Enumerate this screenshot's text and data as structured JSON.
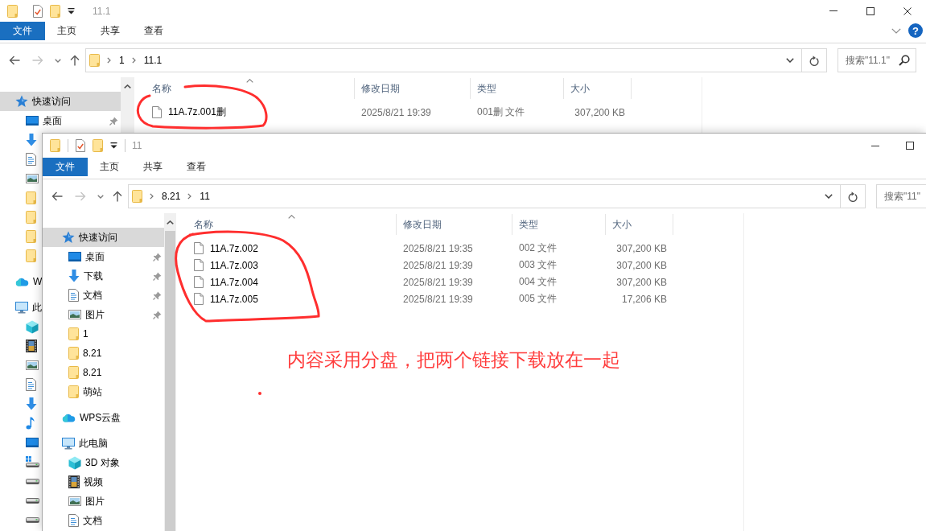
{
  "back_window": {
    "quick_access_toolbar": [
      {
        "kind": "folder"
      },
      {
        "kind": "properties"
      },
      {
        "kind": "folder"
      },
      {
        "kind": "customize"
      }
    ],
    "title": "11.1",
    "controls": [
      {
        "kind": "minimize"
      },
      {
        "kind": "maximize"
      },
      {
        "kind": "close"
      }
    ],
    "ribbon": {
      "tabs": [
        {
          "kind": "file",
          "label": "文件"
        },
        {
          "kind": "tab",
          "label": "主页"
        },
        {
          "kind": "tab",
          "label": "共享"
        },
        {
          "kind": "tab",
          "label": "查看"
        }
      ],
      "expand_toggle": true,
      "help_button": "?"
    },
    "nav_buttons": [
      {
        "kind": "back",
        "disabled": false
      },
      {
        "kind": "forward",
        "disabled": true
      },
      {
        "kind": "recent",
        "disabled": false
      },
      {
        "kind": "up",
        "disabled": false
      }
    ],
    "address": {
      "path": [
        "1",
        "11.1"
      ]
    },
    "search": {
      "placeholder": "搜索\"11.1\""
    },
    "nav_pane": [
      {
        "kind": "quick-access",
        "label": "快速访问",
        "selected": true,
        "pinned": false,
        "children": [
          {
            "kind": "desktop",
            "label": "桌面",
            "selected": false,
            "pinned": true
          },
          {
            "kind": "downloads",
            "selected": false,
            "pinned": false
          },
          {
            "kind": "documents",
            "selected": false,
            "pinned": false
          },
          {
            "kind": "pictures",
            "selected": false,
            "pinned": false
          },
          {
            "kind": "folder",
            "selected": false,
            "pinned": false
          },
          {
            "kind": "folder",
            "selected": false,
            "pinned": false
          },
          {
            "kind": "folder",
            "selected": false,
            "pinned": false
          },
          {
            "kind": "folder",
            "selected": false,
            "pinned": false
          }
        ]
      },
      {
        "kind": "cloud",
        "label": "W",
        "selected": false,
        "pinned": false
      },
      {
        "kind": "computer",
        "label": "此",
        "selected": false,
        "pinned": false,
        "children": [
          {
            "kind": "objects-3d",
            "selected": false,
            "pinned": false
          },
          {
            "kind": "videos",
            "selected": false,
            "pinned": false
          },
          {
            "kind": "pictures",
            "selected": false,
            "pinned": false
          },
          {
            "kind": "documents",
            "selected": false,
            "pinned": false
          },
          {
            "kind": "downloads",
            "selected": false,
            "pinned": false
          },
          {
            "kind": "music",
            "selected": false,
            "pinned": false
          },
          {
            "kind": "desktop",
            "selected": false,
            "pinned": false
          },
          {
            "kind": "system-drive",
            "selected": false,
            "pinned": false
          },
          {
            "kind": "drive",
            "selected": false,
            "pinned": false
          },
          {
            "kind": "drive",
            "selected": false,
            "pinned": false
          },
          {
            "kind": "drive",
            "selected": false,
            "pinned": false
          }
        ]
      }
    ],
    "file_list": {
      "columns": [
        {
          "label": "名称",
          "sorted": true
        },
        {
          "label": "修改日期",
          "sorted": false
        },
        {
          "label": "类型",
          "sorted": false
        },
        {
          "label": "大小",
          "sorted": false
        }
      ],
      "rows": [
        {
          "name": "11A.7z.001删",
          "modified": "2025/8/21 19:39",
          "type": "001删 文件",
          "size": "307,200 KB"
        }
      ]
    }
  },
  "front_window": {
    "quick_access_toolbar": [
      {
        "kind": "folder"
      },
      {
        "kind": "separator"
      },
      {
        "kind": "properties"
      },
      {
        "kind": "folder"
      },
      {
        "kind": "customize"
      },
      {
        "kind": "separator"
      }
    ],
    "title": "11",
    "controls": [
      {
        "kind": "minimize"
      },
      {
        "kind": "maximize"
      }
    ],
    "ribbon": {
      "tabs": [
        {
          "kind": "file",
          "label": "文件"
        },
        {
          "kind": "tab",
          "label": "主页"
        },
        {
          "kind": "tab",
          "label": "共享"
        },
        {
          "kind": "tab",
          "label": "查看"
        }
      ]
    },
    "nav_buttons": [
      {
        "kind": "back",
        "disabled": false
      },
      {
        "kind": "forward",
        "disabled": true
      },
      {
        "kind": "recent",
        "disabled": false
      },
      {
        "kind": "up",
        "disabled": false
      }
    ],
    "address": {
      "path": [
        "8.21",
        "11"
      ]
    },
    "search": {
      "placeholder": "搜索\"11\""
    },
    "nav_pane": [
      {
        "kind": "quick-access",
        "label": "快速访问",
        "selected": true,
        "pinned": false,
        "children": [
          {
            "kind": "desktop",
            "label": "桌面",
            "selected": false,
            "pinned": true
          },
          {
            "kind": "downloads",
            "label": "下载",
            "selected": false,
            "pinned": true
          },
          {
            "kind": "documents",
            "label": "文档",
            "selected": false,
            "pinned": true
          },
          {
            "kind": "pictures",
            "label": "图片",
            "selected": false,
            "pinned": true
          },
          {
            "kind": "folder",
            "label": "1",
            "selected": false,
            "pinned": false
          },
          {
            "kind": "folder",
            "label": "8.21",
            "selected": false,
            "pinned": false
          },
          {
            "kind": "folder",
            "label": "8.21",
            "selected": false,
            "pinned": false
          },
          {
            "kind": "folder",
            "label": "萌站",
            "selected": false,
            "pinned": false
          }
        ]
      },
      {
        "kind": "cloud",
        "label": "WPS云盘",
        "selected": false,
        "pinned": false
      },
      {
        "kind": "computer",
        "label": "此电脑",
        "selected": false,
        "pinned": false,
        "children": [
          {
            "kind": "objects-3d",
            "label": "3D 对象",
            "selected": false,
            "pinned": false
          },
          {
            "kind": "videos",
            "label": "视频",
            "selected": false,
            "pinned": false
          },
          {
            "kind": "pictures",
            "label": "图片",
            "selected": false,
            "pinned": false
          },
          {
            "kind": "documents",
            "label": "文档",
            "selected": false,
            "pinned": false
          }
        ]
      }
    ],
    "file_list": {
      "columns": [
        {
          "label": "名称",
          "sorted": true
        },
        {
          "label": "修改日期",
          "sorted": false
        },
        {
          "label": "类型",
          "sorted": false
        },
        {
          "label": "大小",
          "sorted": false
        }
      ],
      "rows": [
        {
          "name": "11A.7z.002",
          "modified": "2025/8/21 19:35",
          "type": "002 文件",
          "size": "307,200 KB"
        },
        {
          "name": "11A.7z.003",
          "modified": "2025/8/21 19:39",
          "type": "003 文件",
          "size": "307,200 KB"
        },
        {
          "name": "11A.7z.004",
          "modified": "2025/8/21 19:39",
          "type": "004 文件",
          "size": "307,200 KB"
        },
        {
          "name": "11A.7z.005",
          "modified": "2025/8/21 19:39",
          "type": "005 文件",
          "size": "17,206 KB"
        }
      ]
    }
  },
  "annotations": [
    {
      "kind": "circle"
    },
    {
      "kind": "circle"
    },
    {
      "kind": "note",
      "text": "内容采用分盘，把两个链接下载放在一起"
    },
    {
      "kind": "dot"
    }
  ]
}
